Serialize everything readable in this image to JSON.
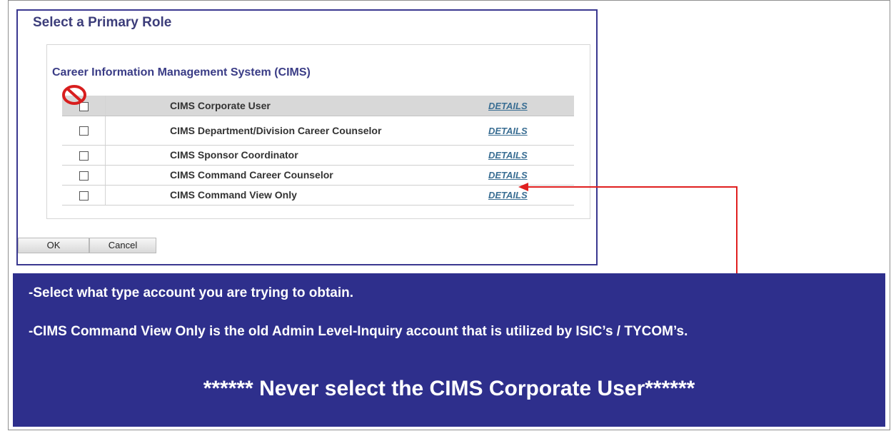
{
  "dialog": {
    "title": "Select a Primary Role",
    "section_title": "Career Information Management System (CIMS)",
    "roles": [
      {
        "name": "CIMS Corporate User",
        "details": "DETAILS"
      },
      {
        "name": "CIMS Department/Division Career Counselor",
        "details": "DETAILS"
      },
      {
        "name": "CIMS Sponsor Coordinator",
        "details": "DETAILS"
      },
      {
        "name": "CIMS Command Career Counselor",
        "details": "DETAILS"
      },
      {
        "name": "CIMS Command View Only",
        "details": "DETAILS"
      }
    ],
    "ok_label": "OK",
    "cancel_label": "Cancel"
  },
  "note": {
    "line1": "-Select what type account you are trying to obtain.",
    "line2": "-CIMS Command View Only is the old Admin Level-Inquiry account that is utilized by ISIC’s / TYCOM’s.",
    "line3": "****** Never select the CIMS Corporate User******"
  },
  "colors": {
    "note_background": "#2e2f8c",
    "dialog_border": "#3a3890",
    "arrow": "#e02020",
    "prohibit_icon": "#d81e1e",
    "details_link": "#3a6e93"
  },
  "icons": {
    "prohibit": "prohibited-icon",
    "arrow": "arrow-callout"
  }
}
